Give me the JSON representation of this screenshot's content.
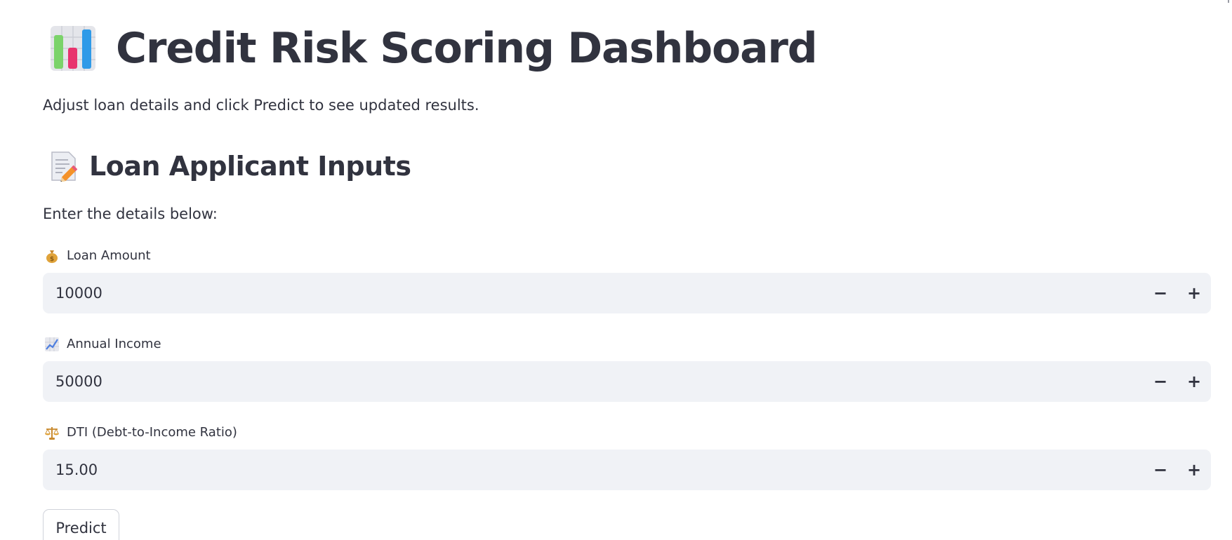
{
  "app": {
    "title": "Credit Risk Scoring Dashboard",
    "title_icon": "bar-chart-emoji",
    "subtitle": "Adjust loan details and click Predict to see updated results."
  },
  "section": {
    "title": "Loan Applicant Inputs",
    "title_icon": "memo-emoji",
    "instructions": "Enter the details below:"
  },
  "fields": [
    {
      "label": "Loan Amount",
      "icon": "money-bag-emoji",
      "value": "10000",
      "decrement_label": "−",
      "increment_label": "+"
    },
    {
      "label": "Annual Income",
      "icon": "chart-increasing-emoji",
      "value": "50000",
      "decrement_label": "−",
      "increment_label": "+"
    },
    {
      "label": "DTI (Debt-to-Income Ratio)",
      "icon": "balance-scale-emoji",
      "value": "15.00",
      "decrement_label": "−",
      "increment_label": "+"
    }
  ],
  "actions": {
    "predict_label": "Predict"
  },
  "colors": {
    "text": "#31333f",
    "input_bg": "#f0f2f6",
    "button_border": "#d0d3da"
  }
}
